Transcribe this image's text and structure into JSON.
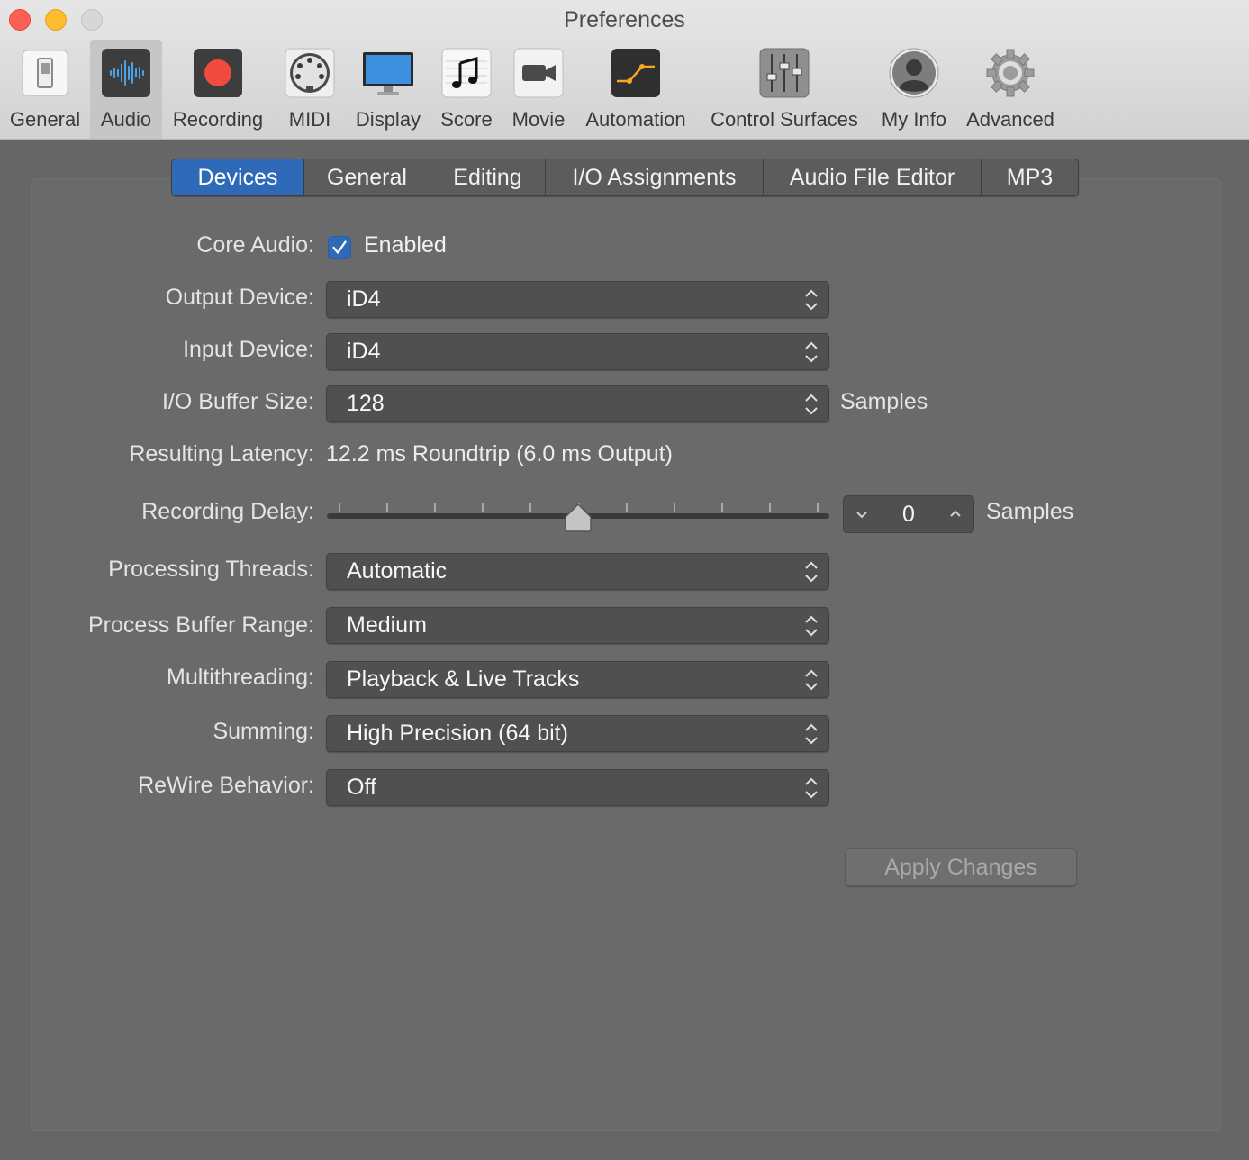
{
  "window": {
    "title": "Preferences"
  },
  "toolbar": {
    "selected": "Audio",
    "items": [
      {
        "label": "General",
        "icon": "switch-icon"
      },
      {
        "label": "Audio",
        "icon": "waveform-icon"
      },
      {
        "label": "Recording",
        "icon": "record-icon"
      },
      {
        "label": "MIDI",
        "icon": "midi-connector-icon"
      },
      {
        "label": "Display",
        "icon": "monitor-icon"
      },
      {
        "label": "Score",
        "icon": "music-note-icon"
      },
      {
        "label": "Movie",
        "icon": "video-camera-icon"
      },
      {
        "label": "Automation",
        "icon": "automation-curve-icon"
      },
      {
        "label": "Control Surfaces",
        "icon": "faders-icon"
      },
      {
        "label": "My Info",
        "icon": "user-icon"
      },
      {
        "label": "Advanced",
        "icon": "gear-icon"
      }
    ]
  },
  "tabs": [
    {
      "label": "Devices",
      "active": true
    },
    {
      "label": "General",
      "active": false
    },
    {
      "label": "Editing",
      "active": false
    },
    {
      "label": "I/O Assignments",
      "active": false
    },
    {
      "label": "Audio File Editor",
      "active": false
    },
    {
      "label": "MP3",
      "active": false
    }
  ],
  "form": {
    "core_audio": {
      "label": "Core Audio:",
      "checkbox_label": "Enabled",
      "checked": true
    },
    "output_device": {
      "label": "Output Device:",
      "value": "iD4"
    },
    "input_device": {
      "label": "Input Device:",
      "value": "iD4"
    },
    "io_buffer": {
      "label": "I/O Buffer Size:",
      "value": "128",
      "unit": "Samples"
    },
    "latency": {
      "label": "Resulting Latency:",
      "value": "12.2 ms Roundtrip (6.0 ms Output)"
    },
    "recording_delay": {
      "label": "Recording Delay:",
      "value": "0",
      "unit": "Samples",
      "slider_fraction": 0.5
    },
    "processing_threads": {
      "label": "Processing Threads:",
      "value": "Automatic"
    },
    "process_buffer_range": {
      "label": "Process Buffer Range:",
      "value": "Medium"
    },
    "multithreading": {
      "label": "Multithreading:",
      "value": "Playback & Live Tracks"
    },
    "summing": {
      "label": "Summing:",
      "value": "High Precision (64 bit)"
    },
    "rewire": {
      "label": "ReWire Behavior:",
      "value": "Off"
    },
    "apply_button": "Apply Changes"
  },
  "colors": {
    "accent": "#2f6ab8",
    "record": "#f04a41",
    "automation": "#f5a623"
  }
}
